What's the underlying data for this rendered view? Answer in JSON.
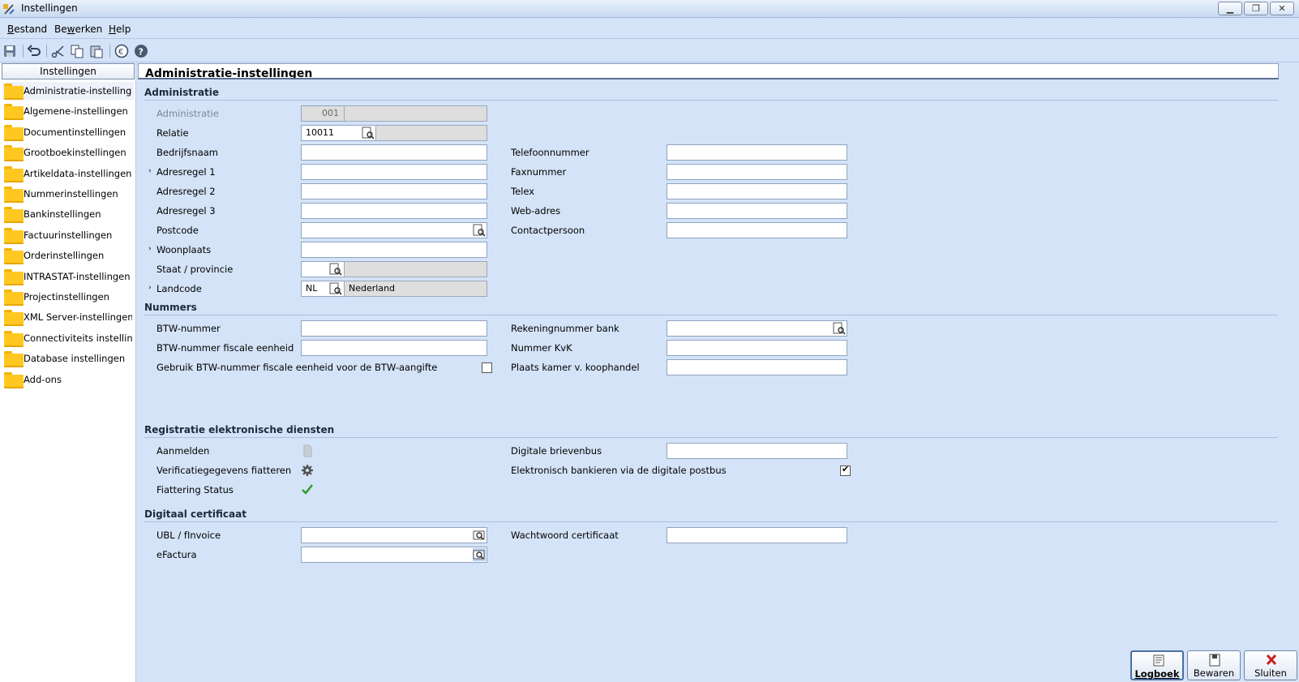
{
  "window": {
    "title": "Instellingen"
  },
  "menu": [
    {
      "label_u": "B",
      "label_rest": "estand"
    },
    {
      "label_pre": "Be",
      "label_u": "w",
      "label_rest": "erken"
    },
    {
      "label_u": "H",
      "label_rest": "elp"
    }
  ],
  "toolbar": {
    "icons": [
      "save-icon",
      "undo-icon",
      "cut-icon",
      "copy-icon",
      "paste-icon",
      "euro-icon",
      "help-icon"
    ]
  },
  "sidebar": {
    "header": "Instellingen",
    "items": [
      {
        "label": "Administratie-instellingen"
      },
      {
        "label": "Algemene-instellingen"
      },
      {
        "label": "Documentinstellingen"
      },
      {
        "label": "Grootboekinstellingen"
      },
      {
        "label": "Artikeldata-instellingen"
      },
      {
        "label": "Nummerinstellingen"
      },
      {
        "label": "Bankinstellingen"
      },
      {
        "label": "Factuurinstellingen"
      },
      {
        "label": "Orderinstellingen"
      },
      {
        "label": "INTRASTAT-instellingen"
      },
      {
        "label": "Projectinstellingen"
      },
      {
        "label": "XML Server-instellingen"
      },
      {
        "label": "Connectiviteits instellin..."
      },
      {
        "label": "Database instellingen"
      },
      {
        "label": "Add-ons"
      }
    ]
  },
  "main": {
    "title": "Administratie-instellingen",
    "sections": {
      "administratie": "Administratie",
      "nummers": "Nummers",
      "registratie": "Registratie elektronische diensten",
      "certificaat": "Digitaal certificaat"
    },
    "administratie": {
      "administratie_label": "Administratie",
      "administratie_value": "001",
      "relatie_label": "Relatie",
      "relatie_value": "10011",
      "bedrijfsnaam_label": "Bedrijfsnaam",
      "adresregel1_label": "Adresregel 1",
      "adresregel2_label": "Adresregel 2",
      "adresregel3_label": "Adresregel 3",
      "postcode_label": "Postcode",
      "woonplaats_label": "Woonplaats",
      "staat_label": "Staat / provincie",
      "landcode_label": "Landcode",
      "landcode_value": "NL",
      "land_name": "Nederland",
      "telefoon_label": "Telefoonnummer",
      "fax_label": "Faxnummer",
      "telex_label": "Telex",
      "web_label": "Web-adres",
      "contact_label": "Contactpersoon"
    },
    "nummers": {
      "btw_label": "BTW-nummer",
      "btw_fiscaal_label": "BTW-nummer fiscale eenheid",
      "gebruik_btw_label": "Gebruik BTW-nummer fiscale eenheid voor de BTW-aangifte",
      "gebruik_btw_checked": false,
      "rekening_label": "Rekeningnummer bank",
      "kvk_label": "Nummer KvK",
      "plaats_kamer_label": "Plaats kamer v. koophandel"
    },
    "registratie": {
      "aanmelden_label": "Aanmelden",
      "verificatie_label": "Verificatiegegevens fiatteren",
      "fiattering_label": "Fiattering Status",
      "brievenbus_label": "Digitale brievenbus",
      "bankieren_label": "Elektronisch bankieren via de digitale postbus",
      "bankieren_checked": true
    },
    "certificaat": {
      "ubl_label": "UBL / fInvoice",
      "efactura_label": "eFactura",
      "wachtwoord_label": "Wachtwoord certificaat"
    }
  },
  "buttons": {
    "logboek": "Logboek",
    "bewaren": "Bewaren",
    "sluiten": "Sluiten"
  },
  "colors": {
    "accent": "#d4e3f7",
    "folder": "#ffc821",
    "check_green": "#2aa02a",
    "close_red": "#cc1f1f"
  }
}
